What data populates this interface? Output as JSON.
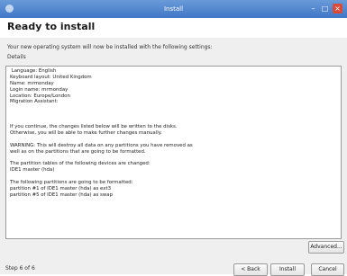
{
  "window": {
    "title": "Install",
    "controls": {
      "minimize": "–",
      "maximize": "□",
      "close": "×"
    }
  },
  "page": {
    "title": "Ready to install",
    "intro": "Your new operating system will now be installed with the following settings:",
    "details_label": "Details"
  },
  "details": {
    "lines": [
      " Language: English",
      "Keyboard layout: United Kingdom",
      "Name: mrmonday",
      "Login name: mrmonday",
      "Location: Europe/London",
      "Migration Assistant:",
      "",
      "",
      "",
      "If you continue, the changes listed below will be written to the disks.",
      "Otherwise, you will be able to make further changes manually.",
      "",
      "WARNING: This will destroy all data on any partitions you have removed as",
      "well as on the partitions that are going to be formatted.",
      "",
      "The partition tables of the following devices are changed:",
      "IDE1 master (hda)",
      "",
      "The following partitions are going to be formatted:",
      "partition #1 of IDE1 master (hda) as ext3",
      "partition #5 of IDE1 master (hda) as swap"
    ]
  },
  "buttons": {
    "advanced": "Advanced...",
    "back": "< Back",
    "install": "Install",
    "cancel": "Cancel"
  },
  "footer": {
    "step": "Step 6 of 6"
  },
  "colors": {
    "titlebar": "#4a80cc",
    "content_bg": "#efefef",
    "close_button": "#d94a3a"
  }
}
